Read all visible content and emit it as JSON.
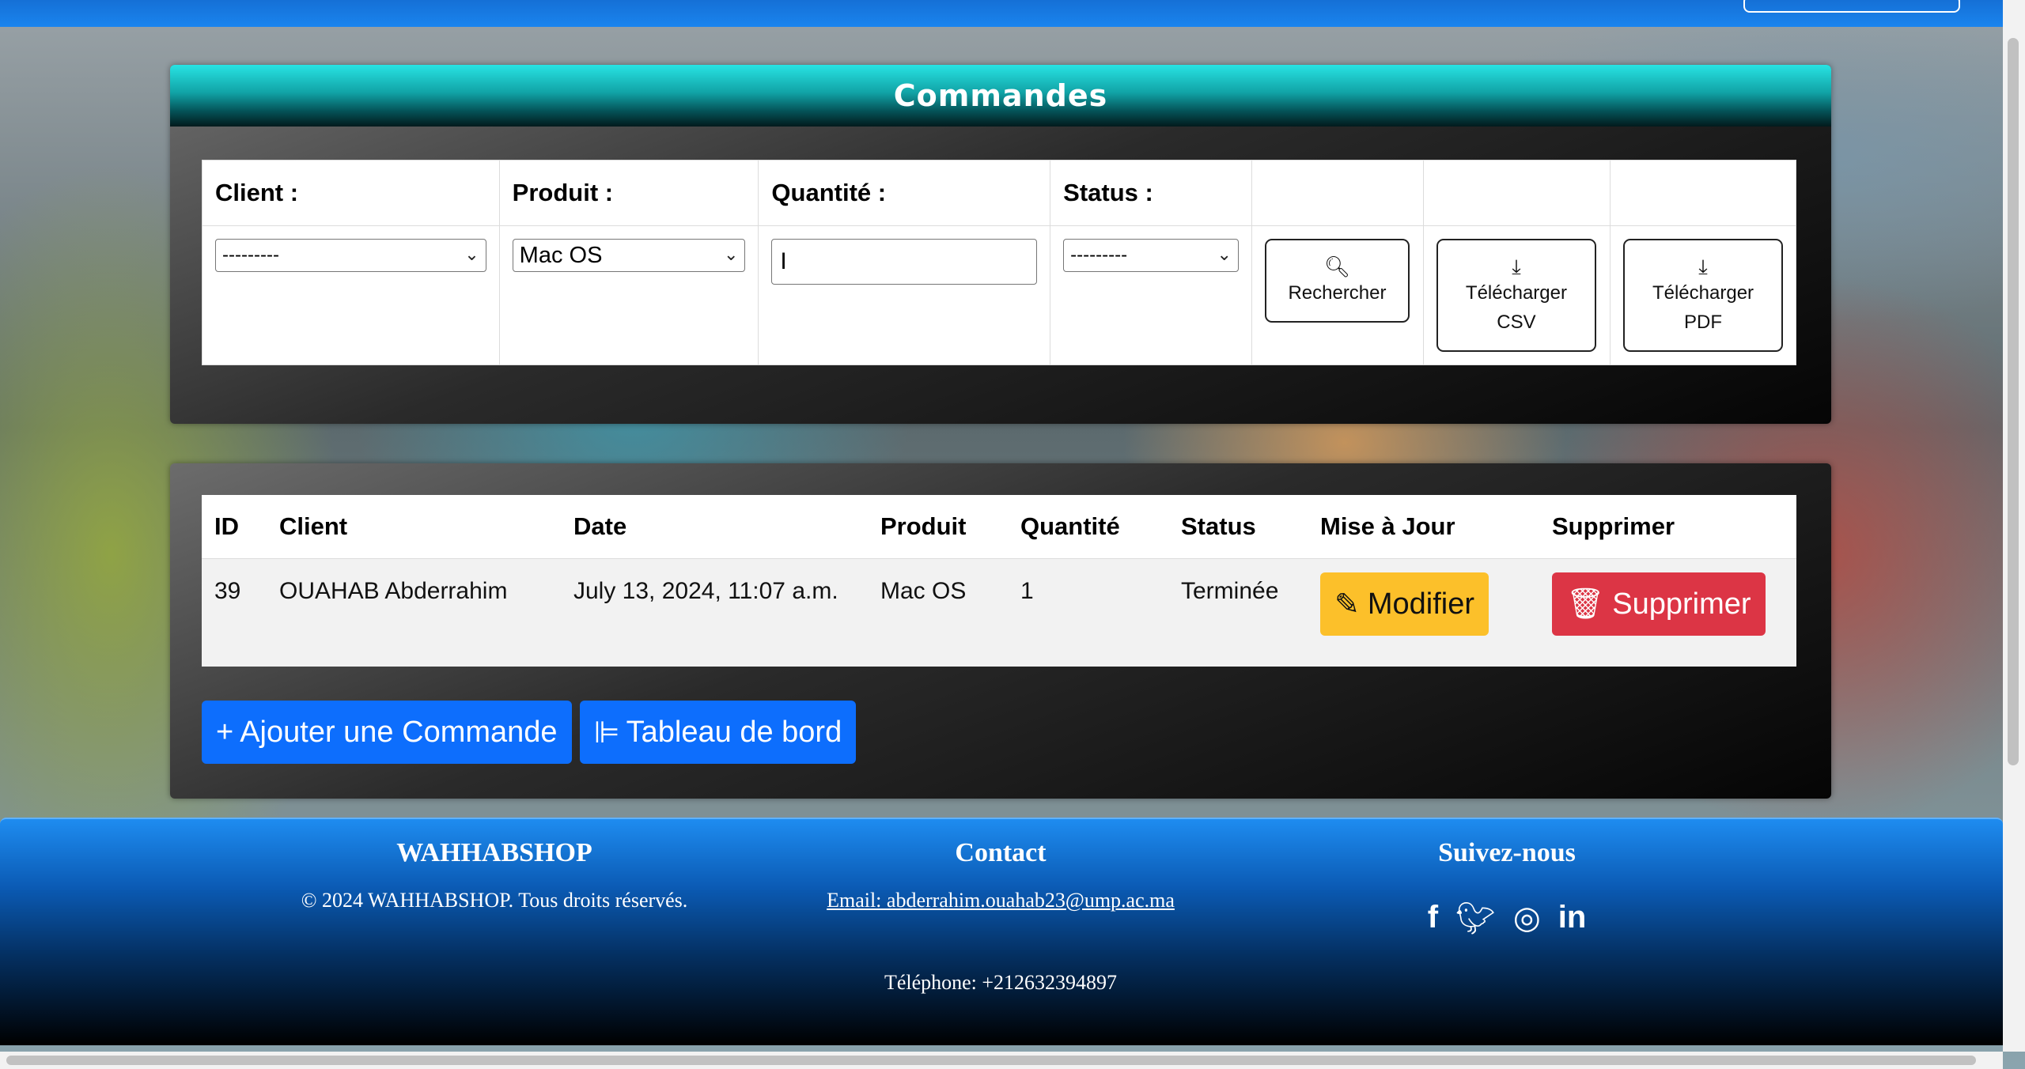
{
  "panel_title": "Commandes",
  "filters": {
    "client_label": "Client :",
    "client_value": "---------",
    "product_label": "Produit :",
    "product_value": "Mac OS",
    "quantity_label": "Quantité :",
    "quantity_value": "I",
    "status_label": "Status :",
    "status_value": "---------",
    "search_label": "Rechercher",
    "csv_label_1": "Télécharger",
    "csv_label_2": "CSV",
    "pdf_label_1": "Télécharger",
    "pdf_label_2": "PDF"
  },
  "orders": {
    "headers": [
      "ID",
      "Client",
      "Date",
      "Produit",
      "Quantité",
      "Status",
      "Mise à Jour",
      "Supprimer"
    ],
    "rows": [
      {
        "id": "39",
        "client": "OUAHAB Abderrahim",
        "date": "July 13, 2024, 11:07 a.m.",
        "product": "Mac OS",
        "quantity": "1",
        "status": "Terminée",
        "modify_label": "Modifier",
        "delete_label": "Supprimer"
      }
    ]
  },
  "actions": {
    "add_order": "Ajouter une Commande",
    "dashboard": "Tableau de bord"
  },
  "footer": {
    "brand_title": "WAHHABSHOP",
    "copyright": "© 2024 WAHHABSHOP. Tous droits réservés.",
    "contact_title": "Contact",
    "email": "Email: abderrahim.ouahab23@ump.ac.ma",
    "phone": "Téléphone: +212632394897",
    "follow_title": "Suivez-nous",
    "social_icons": [
      "facebook-icon",
      "twitter-icon",
      "instagram-icon",
      "linkedin-icon"
    ]
  },
  "colors": {
    "header_teal": "#11a3a6",
    "primary_blue": "#0d6efd",
    "warning_yellow": "#fcc02a",
    "danger_red": "#dc3545"
  }
}
